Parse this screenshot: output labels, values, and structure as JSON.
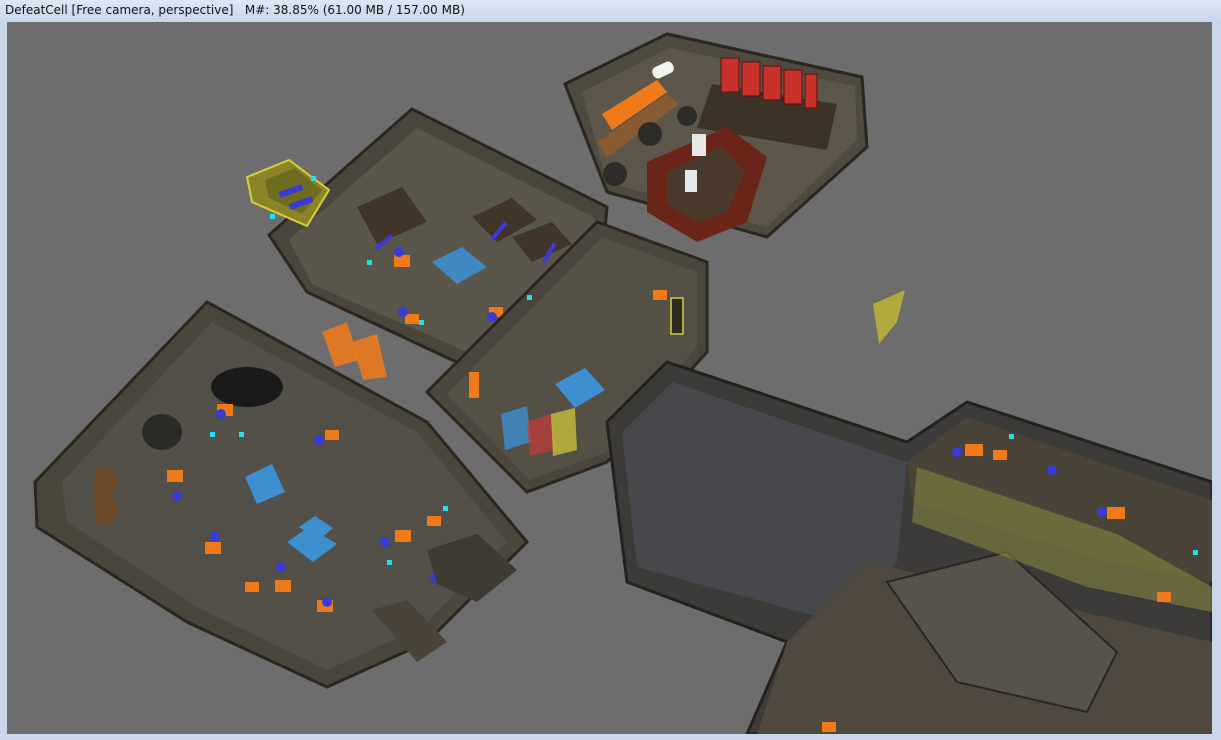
{
  "window": {
    "title": "DefeatCell [Free camera, perspective]",
    "memory_label": "M#: 38.85% (61.00 MB / 157.00 MB)"
  },
  "colors": {
    "viewport_bg": "#6d6d6d",
    "marker_orange": "#f07a1a",
    "marker_blue": "#3a3ad8",
    "marker_cyan": "#22e0e8",
    "marker_light_blue": "#3d8fd0",
    "highlight_yellow": "#d6cf3a",
    "crate_red": "#c8302a"
  },
  "icons": [
    "scene-viewport",
    "npc-marker",
    "light-marker",
    "door-marker"
  ]
}
